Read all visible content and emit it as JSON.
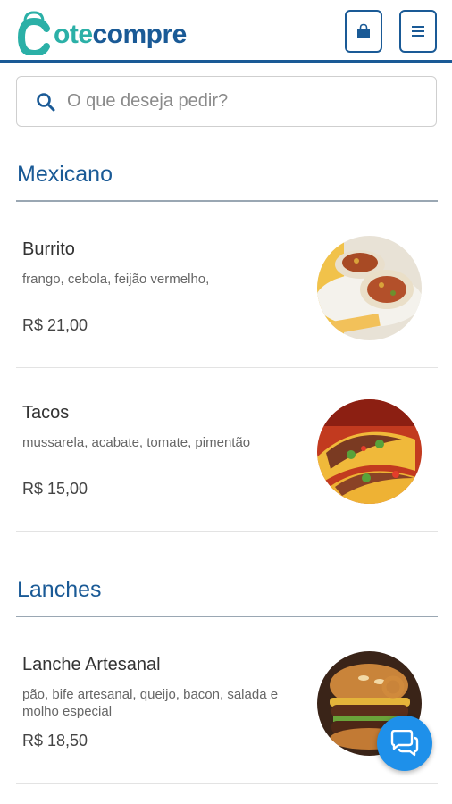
{
  "header": {
    "logo_text_c": "C",
    "logo_text_ote": "ote",
    "logo_text_compre": "compre",
    "cart_icon": "shopping-bag-icon",
    "menu_icon": "hamburger-menu-icon"
  },
  "search": {
    "placeholder": "O que deseja pedir?",
    "icon": "search-icon"
  },
  "sections": [
    {
      "title": "Mexicano",
      "items": [
        {
          "name": "Burrito",
          "description": "frango, cebola, feijão vermelho,",
          "price": "R$ 21,00"
        },
        {
          "name": "Tacos",
          "description": "mussarela, acabate, tomate, pimentão",
          "price": "R$ 15,00"
        }
      ]
    },
    {
      "title": "Lanches",
      "items": [
        {
          "name": "Lanche Artesanal",
          "description": "pão, bife artesanal, queijo, bacon, salada e molho especial",
          "price": "R$ 18,50"
        }
      ]
    }
  ],
  "chat_button": {
    "icon": "chat-bubbles-icon"
  },
  "colors": {
    "brand_blue": "#1a5a96",
    "brand_teal": "#2bb0a7",
    "chat_blue": "#1e90ea"
  }
}
